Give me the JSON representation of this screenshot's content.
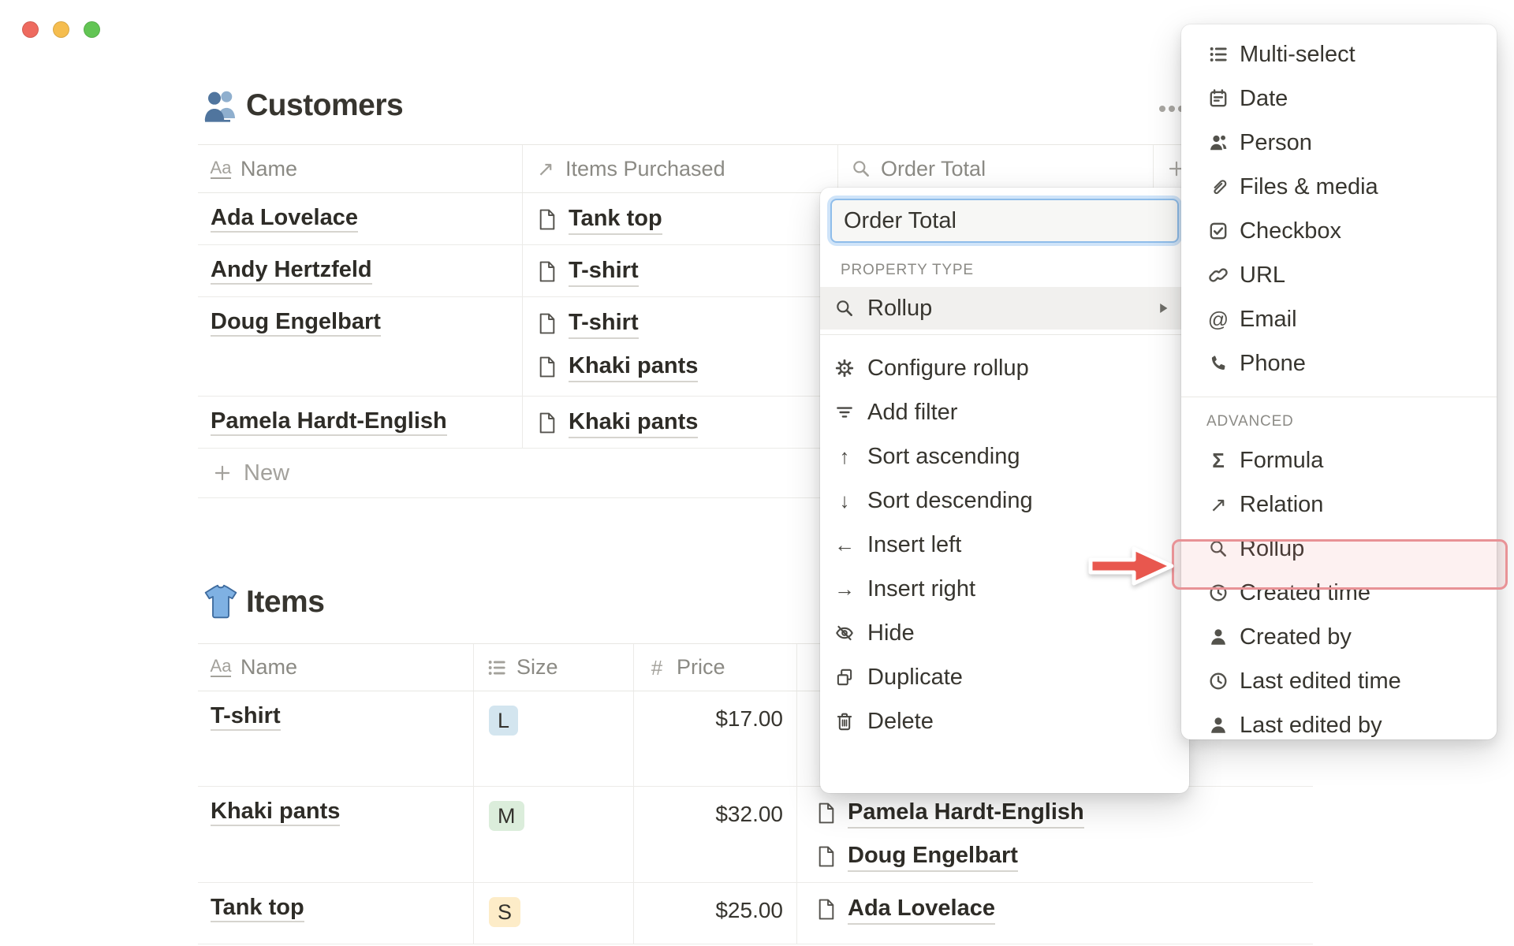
{
  "colors": {
    "traffic_red": "#EE6A5F",
    "traffic_yellow": "#F5BD4F",
    "traffic_green": "#62C554",
    "focus_blue": "#2383E2",
    "annotation_red": "#E8574E",
    "annotation_border": "#E89296",
    "annotation_fill": "rgba(232,116,116,0.10)",
    "tag_blue": "#D3E5EF",
    "tag_green": "#DBEDDB",
    "tag_yellow": "#FDECC8"
  },
  "window": {
    "controls": [
      "close",
      "minimize",
      "zoom"
    ]
  },
  "customers": {
    "emoji": "👥",
    "emoji_icon": "people-emoji",
    "title": "Customers",
    "columns": [
      {
        "icon": "text-icon",
        "label": "Name"
      },
      {
        "icon": "relation-icon",
        "label": "Items Purchased"
      },
      {
        "icon": "rollup-icon",
        "label": "Order Total"
      }
    ],
    "add_column_icon": "plus-icon",
    "options_icon": "ellipsis-icon",
    "rows": [
      {
        "name": "Ada Lovelace",
        "items": [
          "Tank top"
        ]
      },
      {
        "name": "Andy Hertzfeld",
        "items": [
          "T-shirt"
        ]
      },
      {
        "name": "Doug Engelbart",
        "items": [
          "T-shirt",
          "Khaki pants"
        ]
      },
      {
        "name": "Pamela Hardt-English",
        "items": [
          "Khaki pants"
        ]
      }
    ],
    "new_row_label": "New"
  },
  "items": {
    "emoji": "👕",
    "emoji_icon": "tshirt-emoji",
    "title": "Items",
    "columns": [
      {
        "icon": "text-icon",
        "label": "Name"
      },
      {
        "icon": "select-icon",
        "label": "Size"
      },
      {
        "icon": "number-icon",
        "label": "Price"
      }
    ],
    "rows": [
      {
        "name": "T-shirt",
        "size": "L",
        "size_color": "blue",
        "price": "$17.00",
        "purchased_by": []
      },
      {
        "name": "Khaki pants",
        "size": "M",
        "size_color": "green",
        "price": "$32.00",
        "purchased_by": [
          "Pamela Hardt-English",
          "Doug Engelbart"
        ]
      },
      {
        "name": "Tank top",
        "size": "S",
        "size_color": "yellow",
        "price": "$25.00",
        "purchased_by": [
          "Ada Lovelace"
        ]
      }
    ]
  },
  "property_menu": {
    "name_input": {
      "value": "Order Total"
    },
    "section_label": "PROPERTY TYPE",
    "type_row": {
      "icon": "rollup-icon",
      "label": "Rollup",
      "submenu_indicator": "triangle-right-icon"
    },
    "actions": [
      {
        "icon": "gear-icon",
        "label": "Configure rollup"
      },
      {
        "icon": "filter-icon",
        "label": "Add filter"
      },
      {
        "icon": "arrow-up-icon",
        "label": "Sort ascending"
      },
      {
        "icon": "arrow-down-icon",
        "label": "Sort descending"
      },
      {
        "icon": "arrow-left-icon",
        "label": "Insert left"
      },
      {
        "icon": "arrow-right-icon",
        "label": "Insert right"
      },
      {
        "icon": "eye-off-icon",
        "label": "Hide"
      },
      {
        "icon": "duplicate-icon",
        "label": "Duplicate"
      },
      {
        "icon": "trash-icon",
        "label": "Delete"
      }
    ]
  },
  "type_menu": {
    "basic": [
      {
        "icon": "multi-select-icon",
        "label": "Multi-select"
      },
      {
        "icon": "date-icon",
        "label": "Date"
      },
      {
        "icon": "person-icon",
        "label": "Person"
      },
      {
        "icon": "files-icon",
        "label": "Files & media"
      },
      {
        "icon": "checkbox-icon",
        "label": "Checkbox"
      },
      {
        "icon": "url-icon",
        "label": "URL"
      },
      {
        "icon": "email-icon",
        "label": "Email"
      },
      {
        "icon": "phone-icon",
        "label": "Phone"
      }
    ],
    "advanced_label": "ADVANCED",
    "advanced": [
      {
        "icon": "formula-icon",
        "label": "Formula"
      },
      {
        "icon": "relation-icon",
        "label": "Relation"
      },
      {
        "icon": "rollup-icon",
        "label": "Rollup",
        "annotated": true
      },
      {
        "icon": "clock-icon",
        "label": "Created time"
      },
      {
        "icon": "person-filled-icon",
        "label": "Created by"
      },
      {
        "icon": "clock-icon",
        "label": "Last edited time"
      },
      {
        "icon": "person-filled-icon",
        "label": "Last edited by"
      }
    ]
  }
}
